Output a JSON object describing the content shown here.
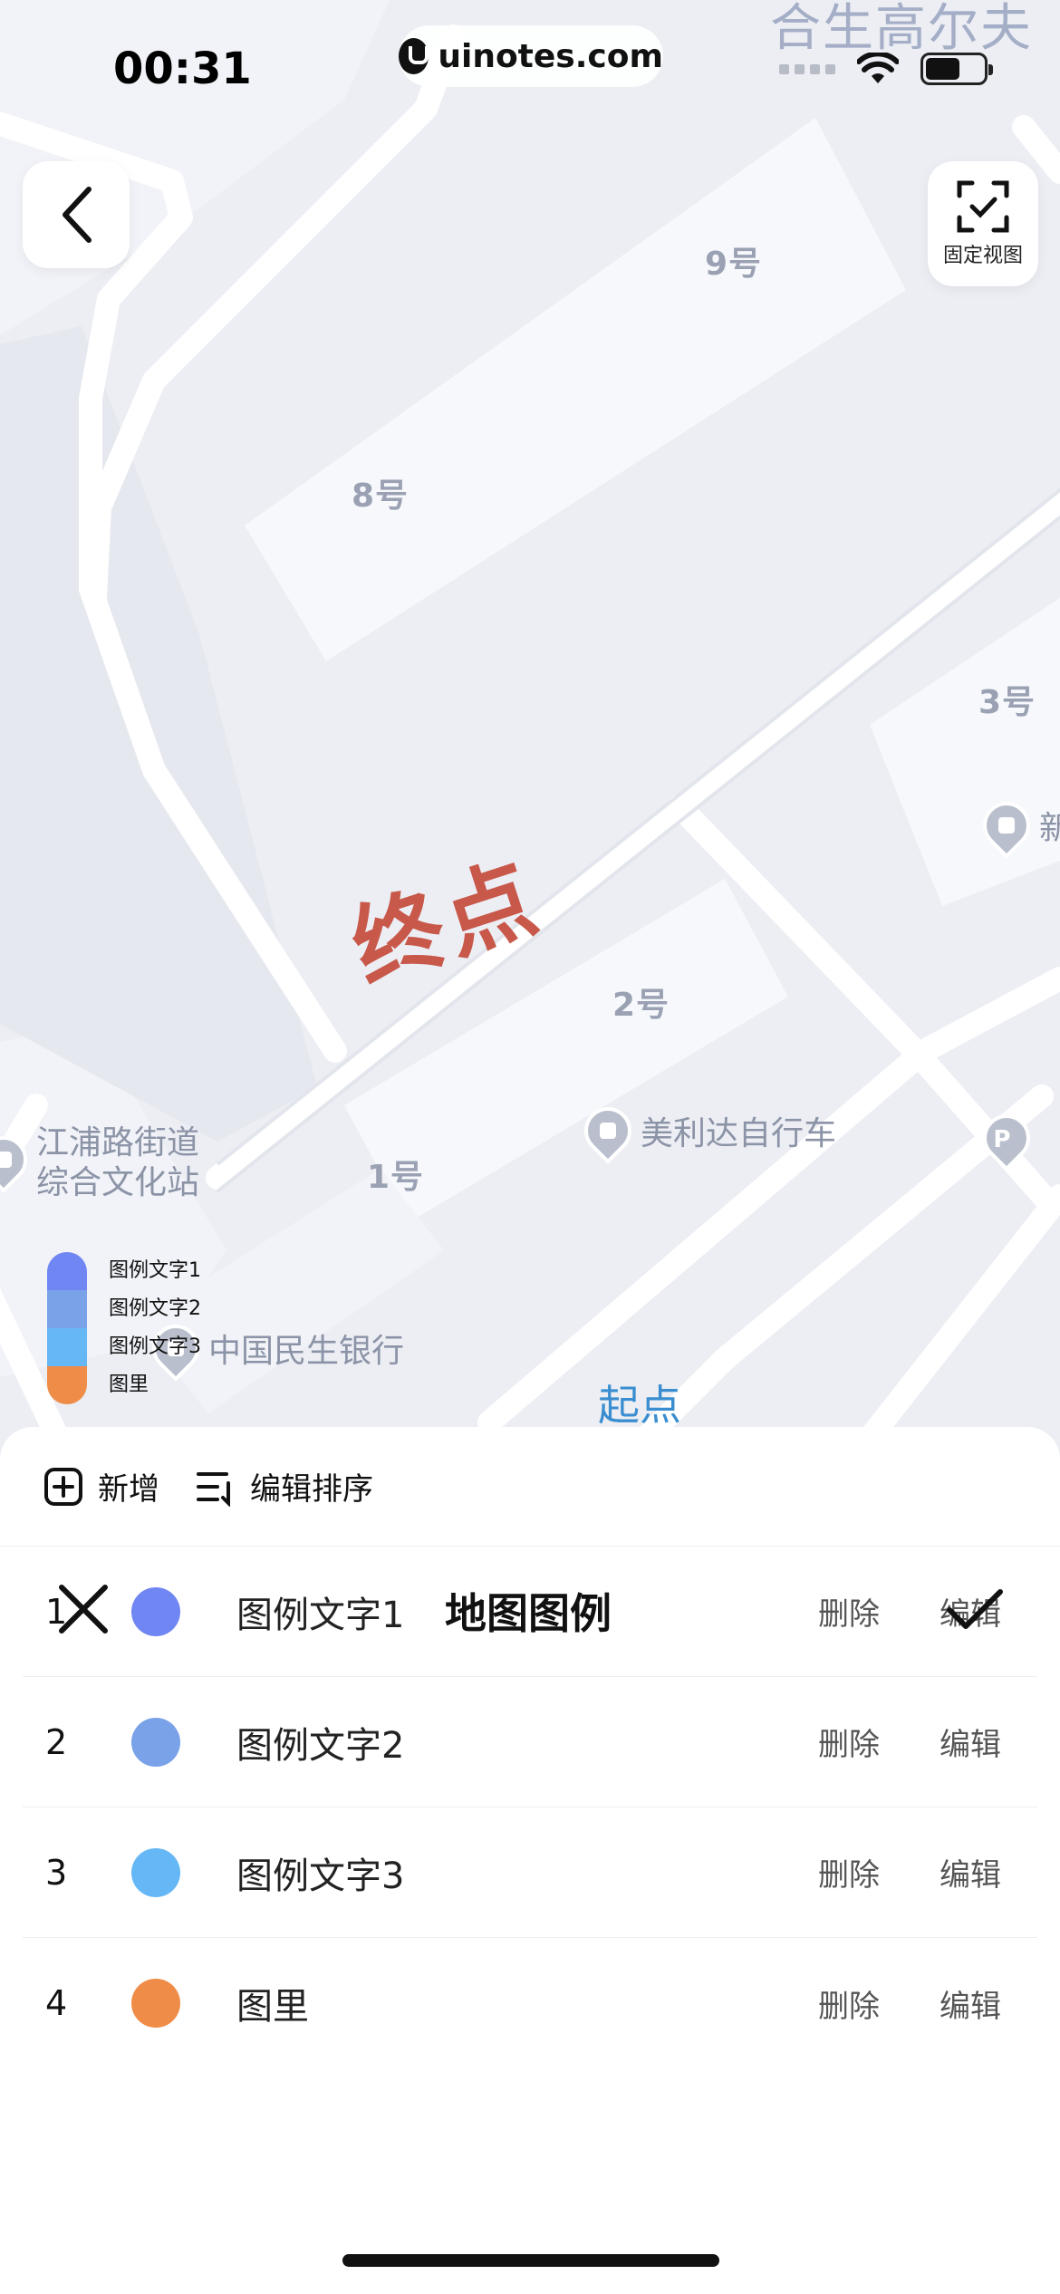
{
  "status_bar": {
    "time": "00:31",
    "url": "uinotes.com",
    "wifi_icon": "wifi-icon",
    "battery_icon": "battery-icon"
  },
  "map": {
    "top_cut_text": "合生高尔夫",
    "buildings": [
      {
        "label": "9号"
      },
      {
        "label": "8号"
      },
      {
        "label": "3号"
      },
      {
        "label": "2号"
      },
      {
        "label": "1号"
      }
    ],
    "pois": [
      {
        "label": "新"
      },
      {
        "label": "美利达自行车"
      },
      {
        "label": "江浦路街道\n综合文化站"
      },
      {
        "label": "中国民生银行"
      },
      {
        "label": ""
      }
    ],
    "end_label": "终点",
    "start_label": "起点",
    "back_button_icon": "chevron-left-icon",
    "fix_view": {
      "label": "固定视图",
      "icon": "scan-check-icon"
    },
    "legend_overlay": [
      {
        "label": "图例文字1",
        "color": "#6f86f3"
      },
      {
        "label": "图例文字2",
        "color": "#79a2e8"
      },
      {
        "label": "图例文字3",
        "color": "#66b7f6"
      },
      {
        "label": "图里",
        "color": "#ef8c47"
      }
    ]
  },
  "sheet": {
    "toolbar": {
      "add_label": "新增",
      "add_icon": "plus-square-icon",
      "sort_label": "编辑排序",
      "sort_icon": "sort-list-icon"
    },
    "items": [
      {
        "index": "1",
        "label": "图例文字1",
        "color": "#6f86f3",
        "delete": "删除",
        "edit": "编辑"
      },
      {
        "index": "2",
        "label": "图例文字2",
        "color": "#79a2e8",
        "delete": "删除",
        "edit": "编辑"
      },
      {
        "index": "3",
        "label": "图例文字3",
        "color": "#66b7f6",
        "delete": "删除",
        "edit": "编辑"
      },
      {
        "index": "4",
        "label": "图里",
        "color": "#ef8c47",
        "delete": "删除",
        "edit": "编辑"
      }
    ],
    "footer": {
      "title": "地图图例",
      "close_icon": "close-icon",
      "confirm_icon": "check-icon"
    }
  }
}
